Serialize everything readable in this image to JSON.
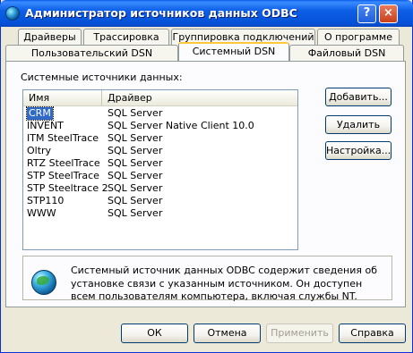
{
  "window": {
    "title": "Администратор источников данных ODBC",
    "help_label": "?",
    "close_label": "×"
  },
  "tabs": {
    "back_row": [
      "Драйверы",
      "Трассировка",
      "Группировка подключений",
      "О программе"
    ],
    "front_row": [
      "Пользовательский DSN",
      "Системный DSN",
      "Файловый DSN"
    ],
    "active": "Системный DSN"
  },
  "main": {
    "group_label": "Системные источники данных:",
    "columns": [
      "Имя",
      "Драйвер"
    ],
    "rows": [
      {
        "name": "CRM",
        "driver": "SQL Server",
        "selected": true
      },
      {
        "name": "INVENT",
        "driver": "SQL Server Native Client 10.0"
      },
      {
        "name": "ITM SteelTrace",
        "driver": "SQL Server"
      },
      {
        "name": "Oltry",
        "driver": "SQL Server"
      },
      {
        "name": "RTZ SteelTrace",
        "driver": "SQL Server"
      },
      {
        "name": "STP SteelTrace",
        "driver": "SQL Server"
      },
      {
        "name": "STP Steeltrace 2",
        "driver": "SQL Server"
      },
      {
        "name": "STP110",
        "driver": "SQL Server"
      },
      {
        "name": "WWW",
        "driver": "SQL Server"
      }
    ],
    "side_buttons": {
      "add": "Добавить...",
      "remove": "Удалить",
      "configure": "Настройка..."
    },
    "info_text": "Системный источник данных ODBC содержит сведения об установке связи с указанным источником. Он доступен всем пользователям компьютера, включая службы NT."
  },
  "footer": {
    "ok": "ОК",
    "cancel": "Отмена",
    "apply": "Применить",
    "help": "Справка"
  }
}
